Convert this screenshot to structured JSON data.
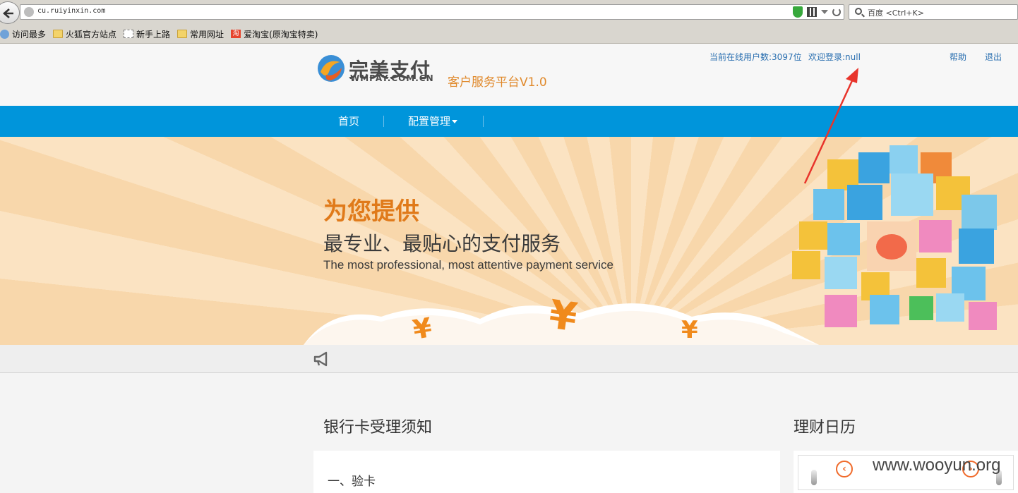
{
  "browser": {
    "url": "cu.ruiyinxin.com",
    "search_placeholder": "百度 <Ctrl+K>",
    "bookmarks": [
      {
        "label": "访问最多",
        "icon": "globe-icon"
      },
      {
        "label": "火狐官方站点",
        "icon": "folder-icon"
      },
      {
        "label": "新手上路",
        "icon": "page-icon"
      },
      {
        "label": "常用网址",
        "icon": "folder-icon"
      },
      {
        "label": "爱淘宝(原淘宝特卖)",
        "icon": "taobao-icon"
      }
    ]
  },
  "header": {
    "logo_cn": "完美支付",
    "logo_en": "WMPAY.COM.CN",
    "platform_title": "客户服务平台V1.0",
    "online_users": "当前在线用户数:3097位",
    "welcome": "欢迎登录:null",
    "help": "帮助",
    "logout": "退出"
  },
  "nav": {
    "items": [
      {
        "label": "首页"
      },
      {
        "label": "配置管理"
      }
    ]
  },
  "banner": {
    "title": "为您提供",
    "subtitle": "最专业、最贴心的支付服务",
    "subtitle_en": "The most professional, most attentive payment service",
    "currency_symbol": "¥"
  },
  "content": {
    "left_title": "银行卡受理须知",
    "left_item": "一、验卡",
    "right_title": "理财日历",
    "watermark": "www.wooyun.org"
  },
  "colors": {
    "nav_bg": "#0095db",
    "accent_orange": "#e07a1a",
    "link_blue": "#2a6fb0",
    "annotation_red": "#e8342b"
  }
}
